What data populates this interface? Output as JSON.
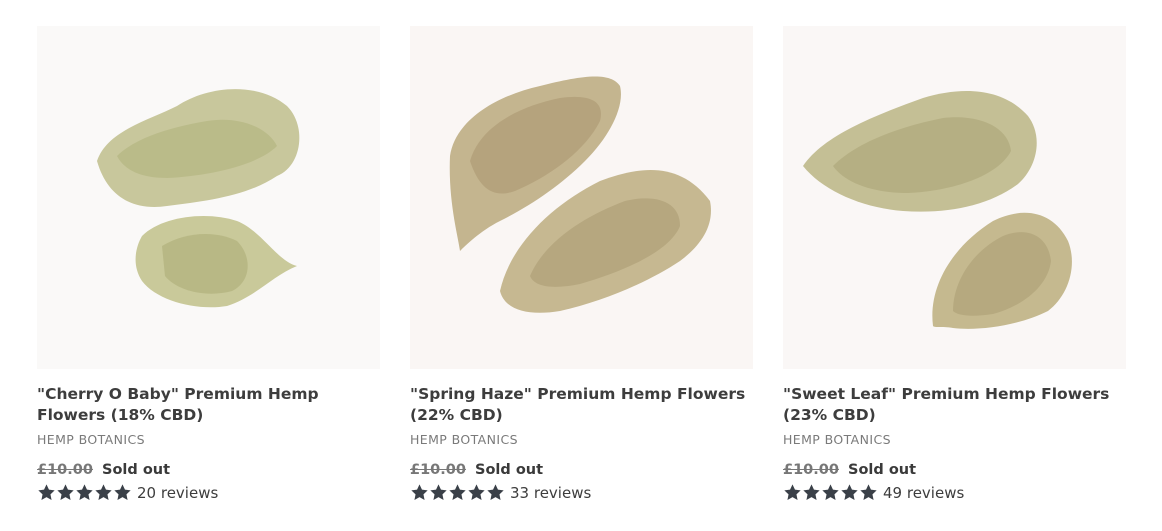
{
  "products": [
    {
      "title": "\"Cherry O Baby\" Premium Hemp Flowers (18% CBD)",
      "vendor": "HEMP BOTANICS",
      "old_price": "£10.00",
      "status": "Sold out",
      "rating": 5,
      "reviews": "20 reviews",
      "image": "hemp-flower-image"
    },
    {
      "title": "\"Spring Haze\" Premium Hemp Flowers (22% CBD)",
      "vendor": "HEMP BOTANICS",
      "old_price": "£10.00",
      "status": "Sold out",
      "rating": 5,
      "reviews": "33 reviews",
      "image": "hemp-flower-image"
    },
    {
      "title": "\"Sweet Leaf\" Premium Hemp Flowers (23% CBD)",
      "vendor": "HEMP BOTANICS",
      "old_price": "£10.00",
      "status": "Sold out",
      "rating": 5,
      "reviews": "49 reviews",
      "image": "hemp-flower-image"
    }
  ],
  "colors": {
    "text": "#3d3d3d",
    "vendor": "#7a7a7a",
    "star": "#3a4048",
    "image_bg": "#faf8f7"
  }
}
